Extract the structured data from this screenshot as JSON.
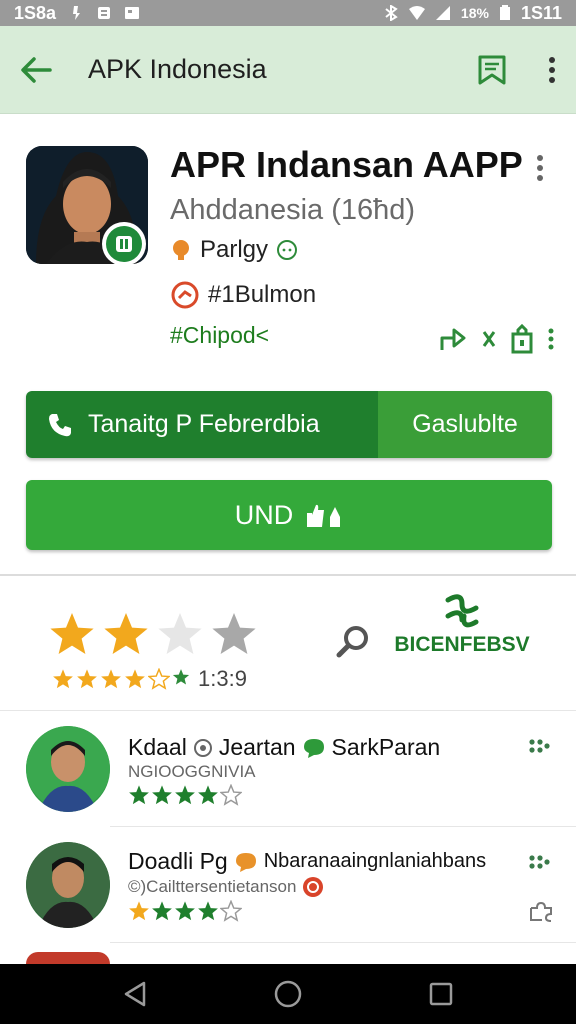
{
  "status_bar": {
    "left_text": "1S8a",
    "battery": "18%",
    "time": "1S11"
  },
  "app_bar": {
    "title": "APK Indonesia"
  },
  "app": {
    "name": "APR Indansan AAPP",
    "subtitle": "Ahddanesia  (16ħd)",
    "meta1": "Parlgy",
    "meta2": "#1Bulmon",
    "tag": "#Chipod<"
  },
  "buttons": {
    "install_main": "Tanaitg P Febrerdbia",
    "install_side": "Gaslublte",
    "und": "UND"
  },
  "rating": {
    "value": "1:3:9",
    "big_stars": 2,
    "big_stars_total": 4,
    "small_stars": 4.5,
    "brand": "BICENFEBSV"
  },
  "reviews": [
    {
      "name": "Kdaal",
      "name_extra": "Jeartan",
      "name_extra2": "SarkParan",
      "sub": "NGIOOGGNIVIA",
      "stars": 4
    },
    {
      "name": "Doadli Pg",
      "name_extra": "Nbaranaaingnlaniahbans",
      "sub": "©)Cailttersentietanson",
      "stars": 4
    }
  ],
  "colors": {
    "app_bar_bg": "#d8ecd8",
    "primary_green": "#1f7f2d",
    "accent_green": "#34a93a",
    "star_gold": "#f2a81d"
  }
}
